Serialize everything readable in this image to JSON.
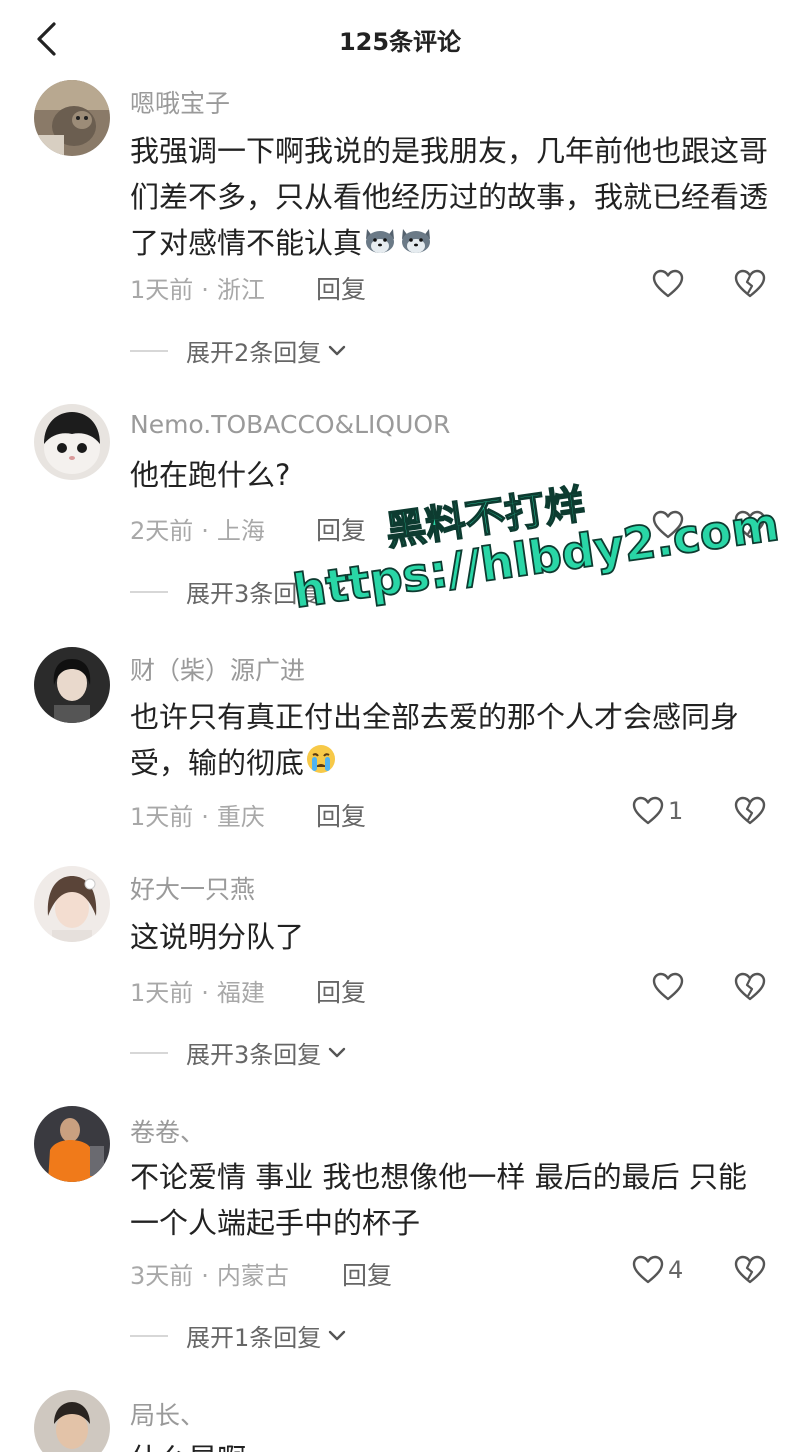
{
  "header": {
    "title": "125条评论"
  },
  "comments": [
    {
      "username": "嗯哦宝子",
      "text": "我强调一下啊我说的是我朋友，几年前他也跟这哥们差不多，只从看他经历过的故事，我就已经看透了对感情不能认真",
      "time": "1天前",
      "location": "浙江",
      "reply_label": "回复",
      "like_count": "",
      "expand_label": "展开2条回复"
    },
    {
      "username": "Nemo.TOBACCO&LIQUOR",
      "text": "他在跑什么?",
      "time": "2天前",
      "location": "上海",
      "reply_label": "回复",
      "like_count": "",
      "expand_label": "展开3条回复"
    },
    {
      "username": "财（柴）源广进",
      "text": "也许只有真正付出全部去爱的那个人才会感同身受，输的彻底",
      "time": "1天前",
      "location": "重庆",
      "reply_label": "回复",
      "like_count": "1",
      "expand_label": ""
    },
    {
      "username": "好大一只燕",
      "text": "这说明分队了",
      "time": "1天前",
      "location": "福建",
      "reply_label": "回复",
      "like_count": "",
      "expand_label": "展开3条回复"
    },
    {
      "username": "卷卷、",
      "text": "不论爱情 事业 我也想像他一样 最后的最后 只能一个人端起手中的杯子",
      "time": "3天前",
      "location": "内蒙古",
      "reply_label": "回复",
      "like_count": "4",
      "expand_label": "展开1条回复"
    },
    {
      "username": "局长、",
      "text": "什么昂啊",
      "time": "",
      "location": "",
      "reply_label": "",
      "like_count": "",
      "expand_label": ""
    }
  ],
  "watermark": {
    "line1": "黑料不打烊",
    "line2": "https://hlbdy2.com"
  },
  "colors": {
    "accent_watermark": "#29d6a6",
    "meta_gray": "#a8a8a8",
    "text": "#222222"
  },
  "icons": [
    "back-arrow-icon",
    "heart-icon",
    "broken-heart-icon",
    "chevron-down-icon",
    "dog-emoji-icon",
    "crying-emoji-icon"
  ]
}
